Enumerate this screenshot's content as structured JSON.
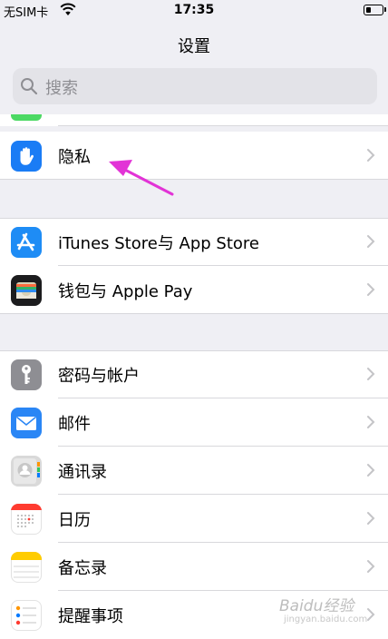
{
  "status_bar": {
    "carrier": "无SIM卡",
    "time": "17:35"
  },
  "nav": {
    "title": "设置"
  },
  "search": {
    "placeholder": "搜索"
  },
  "groups": [
    {
      "items": [
        {
          "label": "隐私",
          "icon": "privacy-hand-icon",
          "color": "#1a7cf5"
        }
      ]
    },
    {
      "items": [
        {
          "label": "iTunes Store与 App Store",
          "icon": "app-store-icon",
          "color": "#1e8cf5"
        },
        {
          "label": "钱包与 Apple Pay",
          "icon": "wallet-icon",
          "color": "#1c1c1e"
        }
      ]
    },
    {
      "items": [
        {
          "label": "密码与帐户",
          "icon": "key-icon",
          "color": "#8e8e93"
        },
        {
          "label": "邮件",
          "icon": "mail-icon",
          "color": "#2a86f5"
        },
        {
          "label": "通讯录",
          "icon": "contacts-icon",
          "color": "#d9d9d9"
        },
        {
          "label": "日历",
          "icon": "calendar-icon",
          "color": "#ffffff"
        },
        {
          "label": "备忘录",
          "icon": "notes-icon",
          "color": "#ffcc00"
        },
        {
          "label": "提醒事项",
          "icon": "reminders-icon",
          "color": "#ffffff"
        }
      ]
    }
  ],
  "annotation": {
    "color": "#e233d6"
  },
  "watermark": {
    "text": "Baidu经验",
    "sub": "jingyan.baidu.com"
  }
}
